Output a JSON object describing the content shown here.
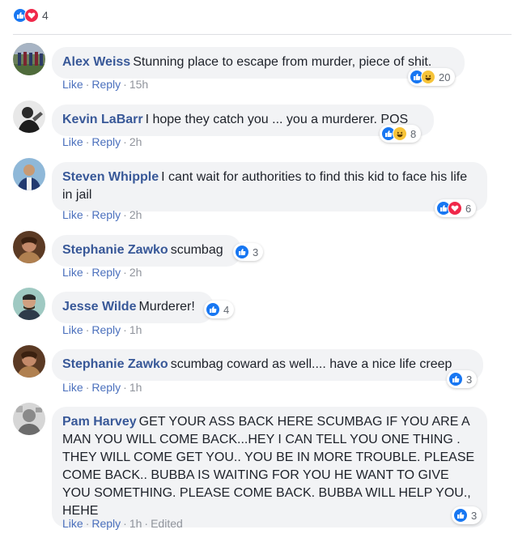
{
  "post_reactions": {
    "icons": [
      "like-icon",
      "love-icon"
    ],
    "count": "4"
  },
  "actions_labels": {
    "like": "Like",
    "reply": "Reply",
    "separator": "·"
  },
  "comments": [
    {
      "author": "Alex Weiss",
      "text": "Stunning place to escape from murder, piece of shit.",
      "time": "15h",
      "reaction_icons": [
        "like-icon",
        "haha-icon"
      ],
      "reaction_count": "20"
    },
    {
      "author": "Kevin LaBarr",
      "text": "I hope they catch you ... you a murderer. POS",
      "time": "2h",
      "reaction_icons": [
        "like-icon",
        "haha-icon"
      ],
      "reaction_count": "8"
    },
    {
      "author": "Steven Whipple",
      "text": "I cant wait for authorities to find this kid to face his life in jail",
      "time": "2h",
      "reaction_icons": [
        "like-icon",
        "love-icon"
      ],
      "reaction_count": "6"
    },
    {
      "author": "Stephanie Zawko",
      "text": "scumbag",
      "time": "2h",
      "reaction_icons": [
        "like-icon"
      ],
      "reaction_count": "3"
    },
    {
      "author": "Jesse Wilde",
      "text": "Murderer!",
      "time": "1h",
      "reaction_icons": [
        "like-icon"
      ],
      "reaction_count": "4"
    },
    {
      "author": "Stephanie Zawko",
      "text": "scumbag coward as well.... have a nice life creep",
      "time": "1h",
      "reaction_icons": [
        "like-icon"
      ],
      "reaction_count": "3"
    },
    {
      "author": "Pam Harvey",
      "text": "GET YOUR ASS BACK HERE SCUMBAG IF YOU ARE A MAN YOU WILL COME BACK...HEY I CAN TELL YOU ONE THING . THEY WILL COME GET YOU.. YOU BE IN MORE TROUBLE. PLEASE COME BACK.. BUBBA IS WAITING FOR YOU HE WANT TO GIVE YOU SOMETHING. PLEASE COME BACK. BUBBA WILL HELP YOU., HEHE",
      "time": "1h",
      "edited": "Edited",
      "reaction_icons": [
        "like-icon"
      ],
      "reaction_count": "3"
    }
  ],
  "colors": {
    "author_link": "#385898",
    "action_link": "#4b70bd",
    "bubble_bg": "#f2f3f5",
    "like": "#1877f2",
    "love": "#f0284a",
    "haha": "#f7c439",
    "meta_gray": "#90949c"
  }
}
